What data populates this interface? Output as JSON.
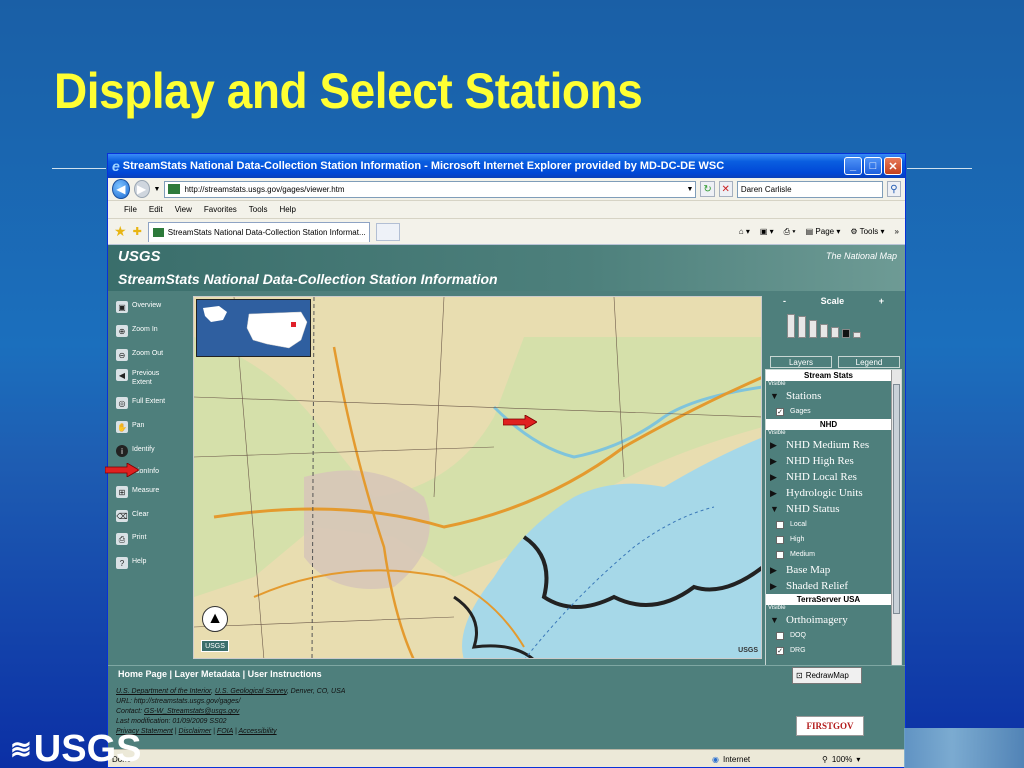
{
  "slide": {
    "title": "Display and Select Stations",
    "logo_text": "USGS"
  },
  "window": {
    "title": "StreamStats National Data-Collection Station Information - Microsoft Internet Explorer provided by MD-DC-DE WSC",
    "address": "http://streamstats.usgs.gov/gages/viewer.htm",
    "search_value": "Daren Carlisle",
    "menu": [
      "File",
      "Edit",
      "View",
      "Favorites",
      "Tools",
      "Help"
    ],
    "tab_label": "StreamStats National Data-Collection Station Informat...",
    "cmd": {
      "page": "Page",
      "tools": "Tools"
    },
    "status_left": "Done",
    "status_zone": "Internet",
    "status_zoom": "100%"
  },
  "app": {
    "logo": "USGS",
    "national_map": "The National Map",
    "title": "StreamStats National Data-Collection Station Information",
    "tools": [
      "Overview",
      "Zoom In",
      "Zoom Out",
      "Previous Extent",
      "Full Extent",
      "Pan",
      "Identify",
      "StationInfo",
      "Measure",
      "Clear",
      "Print",
      "Help"
    ],
    "stationinfo_visible": "tionInfo",
    "scale": {
      "minus": "-",
      "label": "Scale",
      "plus": "+"
    },
    "panel_tabs": {
      "layers": "Layers",
      "legend": "Legend"
    },
    "groups": {
      "stream_stats": "Stream Stats",
      "nhd": "NHD",
      "terraserver": "TerraServer USA",
      "visible": "Visible"
    },
    "layers": {
      "stations": "Stations",
      "gages": "Gages",
      "nhd_medium": "NHD Medium Res",
      "nhd_high": "NHD High Res",
      "nhd_local": "NHD Local Res",
      "hydrologic": "Hydrologic Units",
      "nhd_status": "NHD Status",
      "local": "Local",
      "high": "High",
      "medium": "Medium",
      "base_map": "Base Map",
      "shaded_relief": "Shaded Relief",
      "ortho": "Orthoimagery",
      "doq": "DOQ",
      "drg": "DRG"
    },
    "map_badge": "USGS",
    "map_badge2": "USGS",
    "links": "Home Page | Layer Metadata | User Instructions",
    "redraw": "RedrawMap",
    "footer": {
      "line1_a": "U.S. Department of the Interior",
      "line1_b": "U.S. Geological Survey",
      "line1_c": ", Denver, CO, USA",
      "line2": "URL: http://streamstats.usgs.gov/gages/",
      "line3_a": "Contact: ",
      "line3_b": "GS-W_Streamstats@usgs.gov",
      "line4": "Last modification: 01/09/2009 SS02",
      "line5_a": "Privacy Statement",
      "line5_b": "Disclaimer",
      "line5_c": "FOIA",
      "line5_d": "Accessibility"
    },
    "firstgov": "FIRSTGOV"
  },
  "colors": {
    "title_yellow": "#ffff33",
    "app_teal": "#4e7f7c",
    "highlight_red": "#e02020"
  }
}
